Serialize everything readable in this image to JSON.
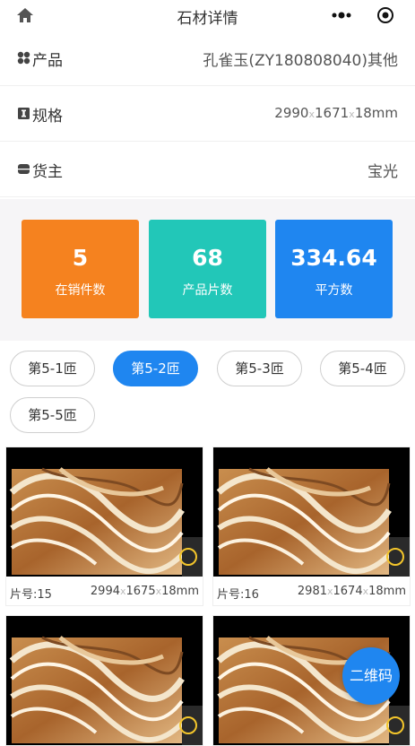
{
  "nav": {
    "title": "石材详情",
    "home_icon": "home-icon",
    "more_icon": "more-dots-icon",
    "close_icon": "target-close-icon"
  },
  "info": {
    "product": {
      "label": "产品",
      "value": "孔雀玉(ZY180808040)其他"
    },
    "spec": {
      "label": "规格",
      "length": "2990",
      "width": "1671",
      "thickness": "18mm",
      "sep": "x"
    },
    "owner": {
      "label": "货主",
      "value": "宝光"
    }
  },
  "stats": [
    {
      "value": "5",
      "label": "在销件数",
      "color": "#f5821f"
    },
    {
      "value": "68",
      "label": "产品片数",
      "color": "#22c7b8"
    },
    {
      "value": "334.64",
      "label": "平方数",
      "color": "#1f86f0"
    }
  ],
  "tabs": [
    {
      "label": "第5-1匝",
      "active": false
    },
    {
      "label": "第5-2匝",
      "active": true
    },
    {
      "label": "第5-3匝",
      "active": false
    },
    {
      "label": "第5-4匝",
      "active": false
    },
    {
      "label": "第5-5匝",
      "active": false
    }
  ],
  "slabs": [
    {
      "no": "片号:15",
      "length": "2994",
      "width": "1675",
      "thickness": "18mm"
    },
    {
      "no": "片号:16",
      "length": "2981",
      "width": "1674",
      "thickness": "18mm"
    },
    {
      "no": "",
      "length": "",
      "width": "",
      "thickness": ""
    },
    {
      "no": "",
      "length": "",
      "width": "",
      "thickness": ""
    }
  ],
  "qr_button": {
    "label": "二维码"
  }
}
